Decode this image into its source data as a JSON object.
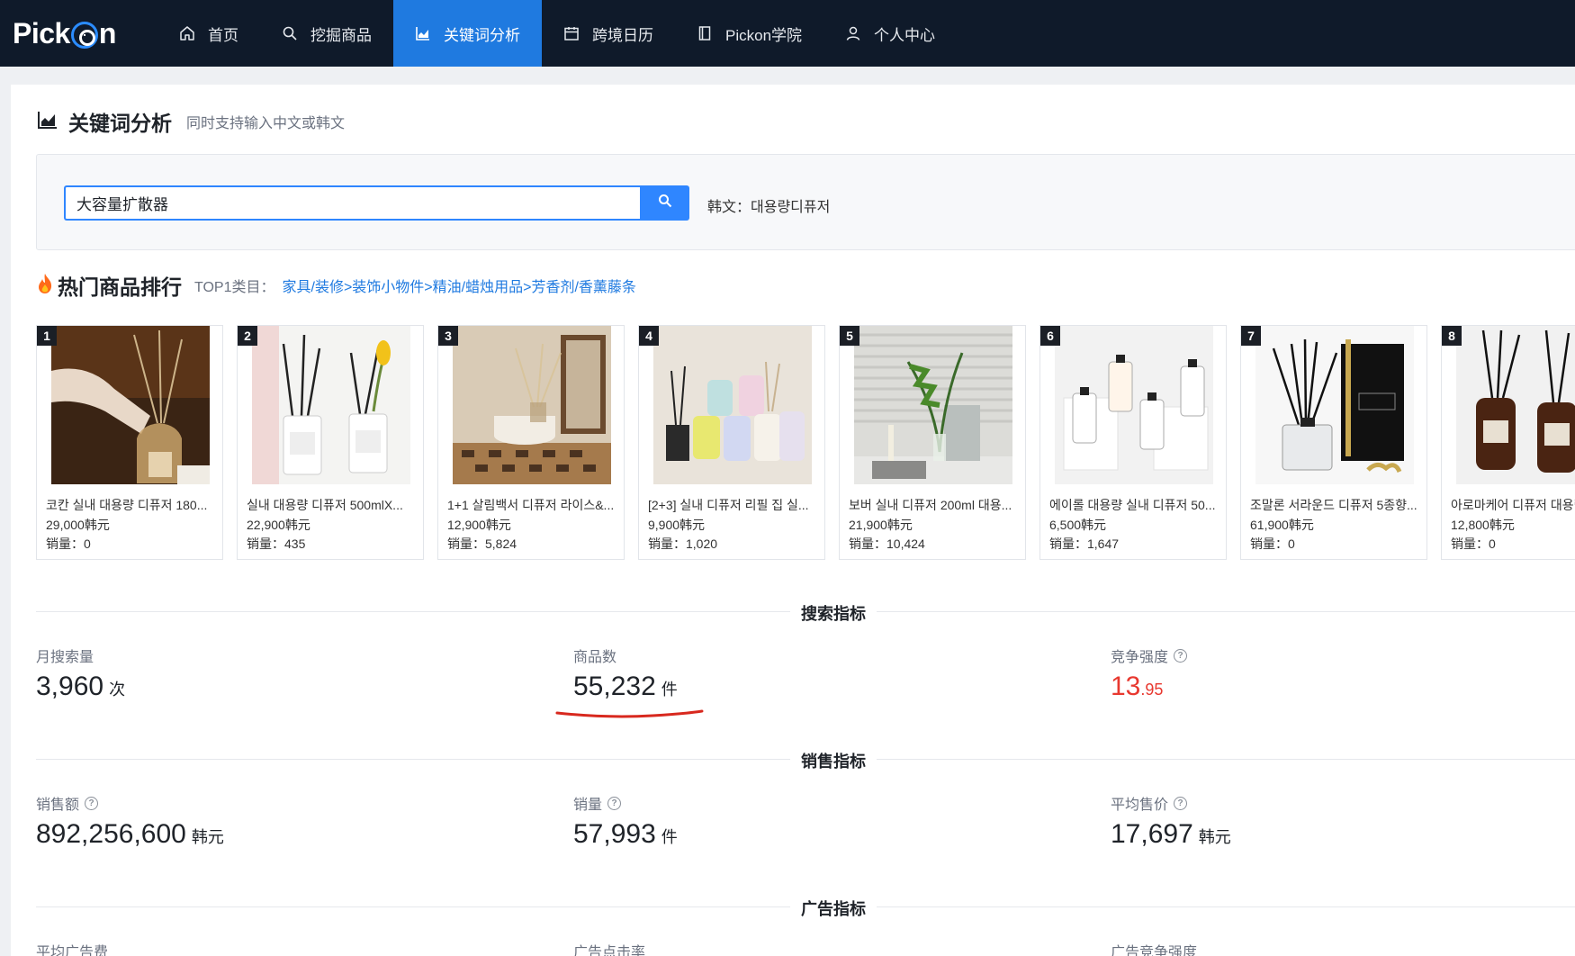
{
  "nav": {
    "logo": "Pick n",
    "items": [
      {
        "label": "首页",
        "icon": "home-icon"
      },
      {
        "label": "挖掘商品",
        "icon": "search-icon"
      },
      {
        "label": "关键词分析",
        "icon": "chart-icon"
      },
      {
        "label": "跨境日历",
        "icon": "calendar-icon"
      },
      {
        "label": "Pickon学院",
        "icon": "book-icon"
      },
      {
        "label": "个人中心",
        "icon": "user-icon"
      }
    ],
    "active_color": "#1f7ae0"
  },
  "page": {
    "title": "关键词分析",
    "subtitle": "同时支持输入中文或韩文"
  },
  "search": {
    "value": "大容量扩散器",
    "korean_label": "韩文：",
    "korean_value": "대용량디퓨저"
  },
  "hot": {
    "title": "热门商品排行",
    "top_label": "TOP1类目：",
    "category": "家具/装修>装饰小物件>精油/蜡烛用品>芳香剂/香薰藤条"
  },
  "products": [
    {
      "rank": "1",
      "name": "코칸 실내 대용량 디퓨저 180...",
      "price": "29,000韩元",
      "sales": "销量：0"
    },
    {
      "rank": "2",
      "name": "실내 대용량 디퓨저 500mlX...",
      "price": "22,900韩元",
      "sales": "销量：435"
    },
    {
      "rank": "3",
      "name": "1+1 살림백서 디퓨저 라이스&...",
      "price": "12,900韩元",
      "sales": "销量：5,824"
    },
    {
      "rank": "4",
      "name": "[2+3] 실내 디퓨저 리필 집 실...",
      "price": "9,900韩元",
      "sales": "销量：1,020"
    },
    {
      "rank": "5",
      "name": "보버 실내 디퓨저 200ml 대용...",
      "price": "21,900韩元",
      "sales": "销量：10,424"
    },
    {
      "rank": "6",
      "name": "에이롤 대용량 실내 디퓨저 50...",
      "price": "6,500韩元",
      "sales": "销量：1,647"
    },
    {
      "rank": "7",
      "name": "조말론 서라운드 디퓨저 5종향...",
      "price": "61,900韩元",
      "sales": "销量：0"
    },
    {
      "rank": "8",
      "name": "아로마케어 디퓨저 대용량",
      "price": "12,800韩元",
      "sales": "销量：0"
    }
  ],
  "search_metrics": {
    "title": "搜索指标",
    "monthly_label": "月搜索量",
    "monthly_value": "3,960",
    "monthly_unit": "次",
    "products_label": "商品数",
    "products_value": "55,232",
    "products_unit": "件",
    "competition_label": "竞争强度",
    "competition_int": "13",
    "competition_dec": ".95"
  },
  "sales_metrics": {
    "title": "销售指标",
    "revenue_label": "销售额",
    "revenue_value": "892,256,600",
    "revenue_unit": "韩元",
    "volume_label": "销量",
    "volume_value": "57,993",
    "volume_unit": "件",
    "avg_price_label": "平均售价",
    "avg_price_value": "17,697",
    "avg_price_unit": "韩元"
  },
  "ad_metrics": {
    "title": "广告指标",
    "avg_fee_label": "平均广告费",
    "ctr_label": "广告点击率",
    "competition_label": "广告竞争强度"
  }
}
